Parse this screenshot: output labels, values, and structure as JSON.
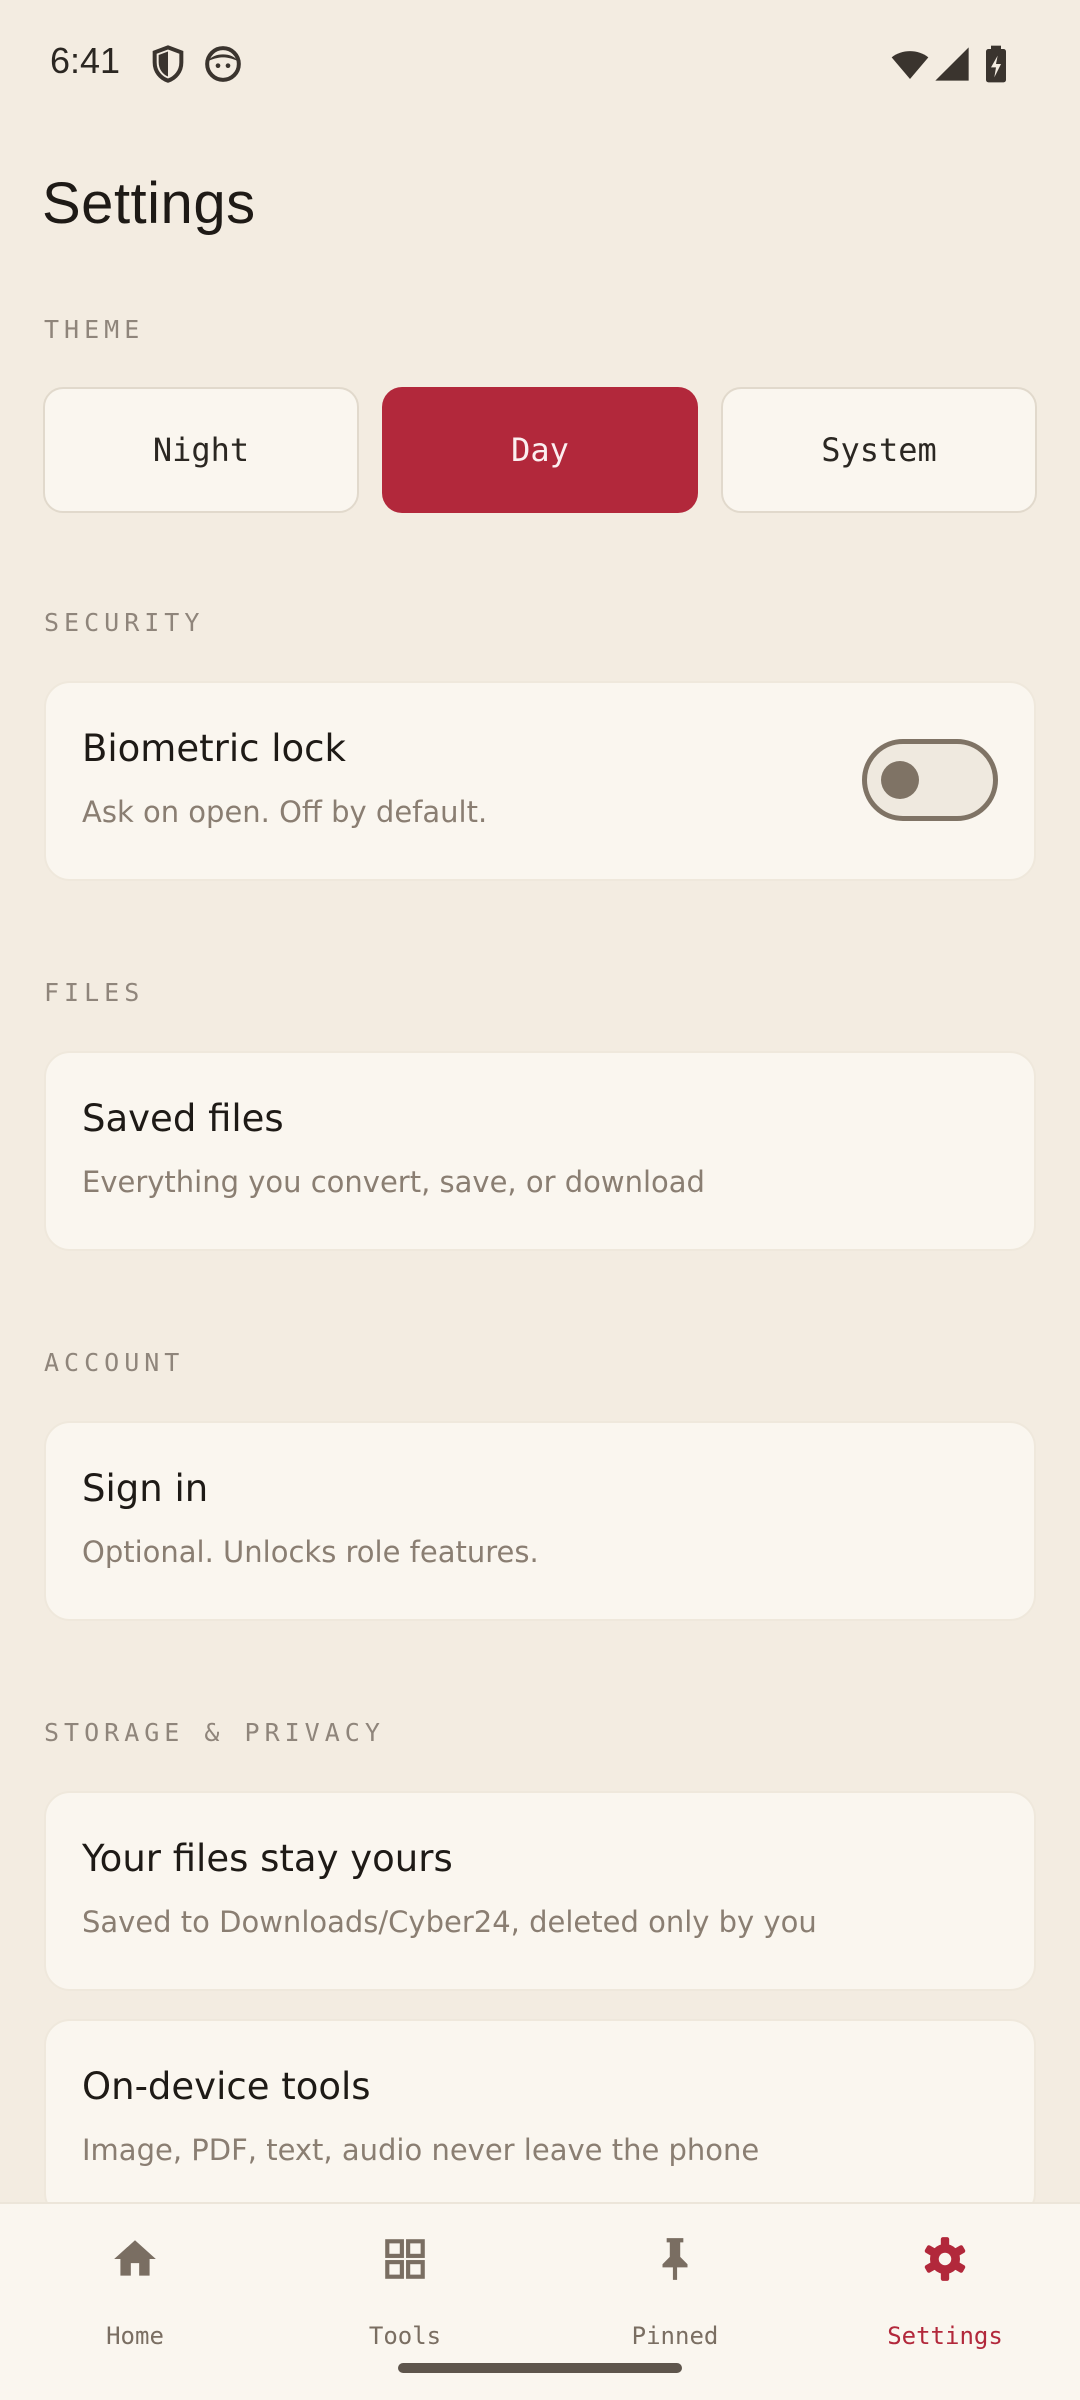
{
  "status_bar": {
    "time": "6:41",
    "left_icons": [
      "shield-icon",
      "face-icon"
    ],
    "right_icons": [
      "wifi-icon",
      "cell-signal-icon",
      "battery-charging-icon"
    ]
  },
  "page": {
    "title": "Settings"
  },
  "sections": {
    "theme": {
      "header": "THEME",
      "options": [
        "Night",
        "Day",
        "System"
      ],
      "selected": "Day"
    },
    "security": {
      "header": "SECURITY",
      "biometric": {
        "title": "Biometric lock",
        "subtitle": "Ask on open. Off by default.",
        "enabled": false
      }
    },
    "files": {
      "header": "FILES",
      "saved": {
        "title": "Saved files",
        "subtitle": "Everything you convert, save, or download"
      }
    },
    "account": {
      "header": "ACCOUNT",
      "signin": {
        "title": "Sign in",
        "subtitle": "Optional. Unlocks role features."
      }
    },
    "storage": {
      "header": "STORAGE & PRIVACY",
      "files_stay": {
        "title": "Your files stay yours",
        "subtitle": "Saved to Downloads/Cyber24, deleted only by you"
      },
      "on_device": {
        "title": "On-device tools",
        "subtitle": "Image, PDF, text, audio never leave the phone"
      }
    }
  },
  "bottom_nav": {
    "items": [
      {
        "label": "Home",
        "icon": "home-icon"
      },
      {
        "label": "Tools",
        "icon": "grid-icon"
      },
      {
        "label": "Pinned",
        "icon": "pin-icon"
      },
      {
        "label": "Settings",
        "icon": "gear-icon"
      }
    ],
    "active": "Settings"
  },
  "colors": {
    "background": "#f3ece1",
    "card": "#faf6ef",
    "accent": "#b2283b",
    "muted_text": "#8a7e72",
    "section_header": "#8f857b"
  }
}
